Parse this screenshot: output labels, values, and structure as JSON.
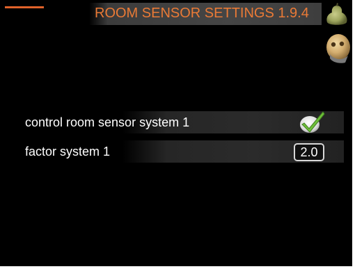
{
  "header": {
    "title": "ROOM SENSOR SETTINGS 1.9.4",
    "accent_color": "#ea7a36",
    "menu_icon": "pear-menu-icon",
    "help_icon": "help-face-icon"
  },
  "settings": [
    {
      "label": "control room sensor system 1",
      "control": "checkbox",
      "checked": true,
      "icon": "check-icon"
    },
    {
      "label": "factor system 1",
      "control": "number",
      "value": "2.0"
    }
  ]
}
